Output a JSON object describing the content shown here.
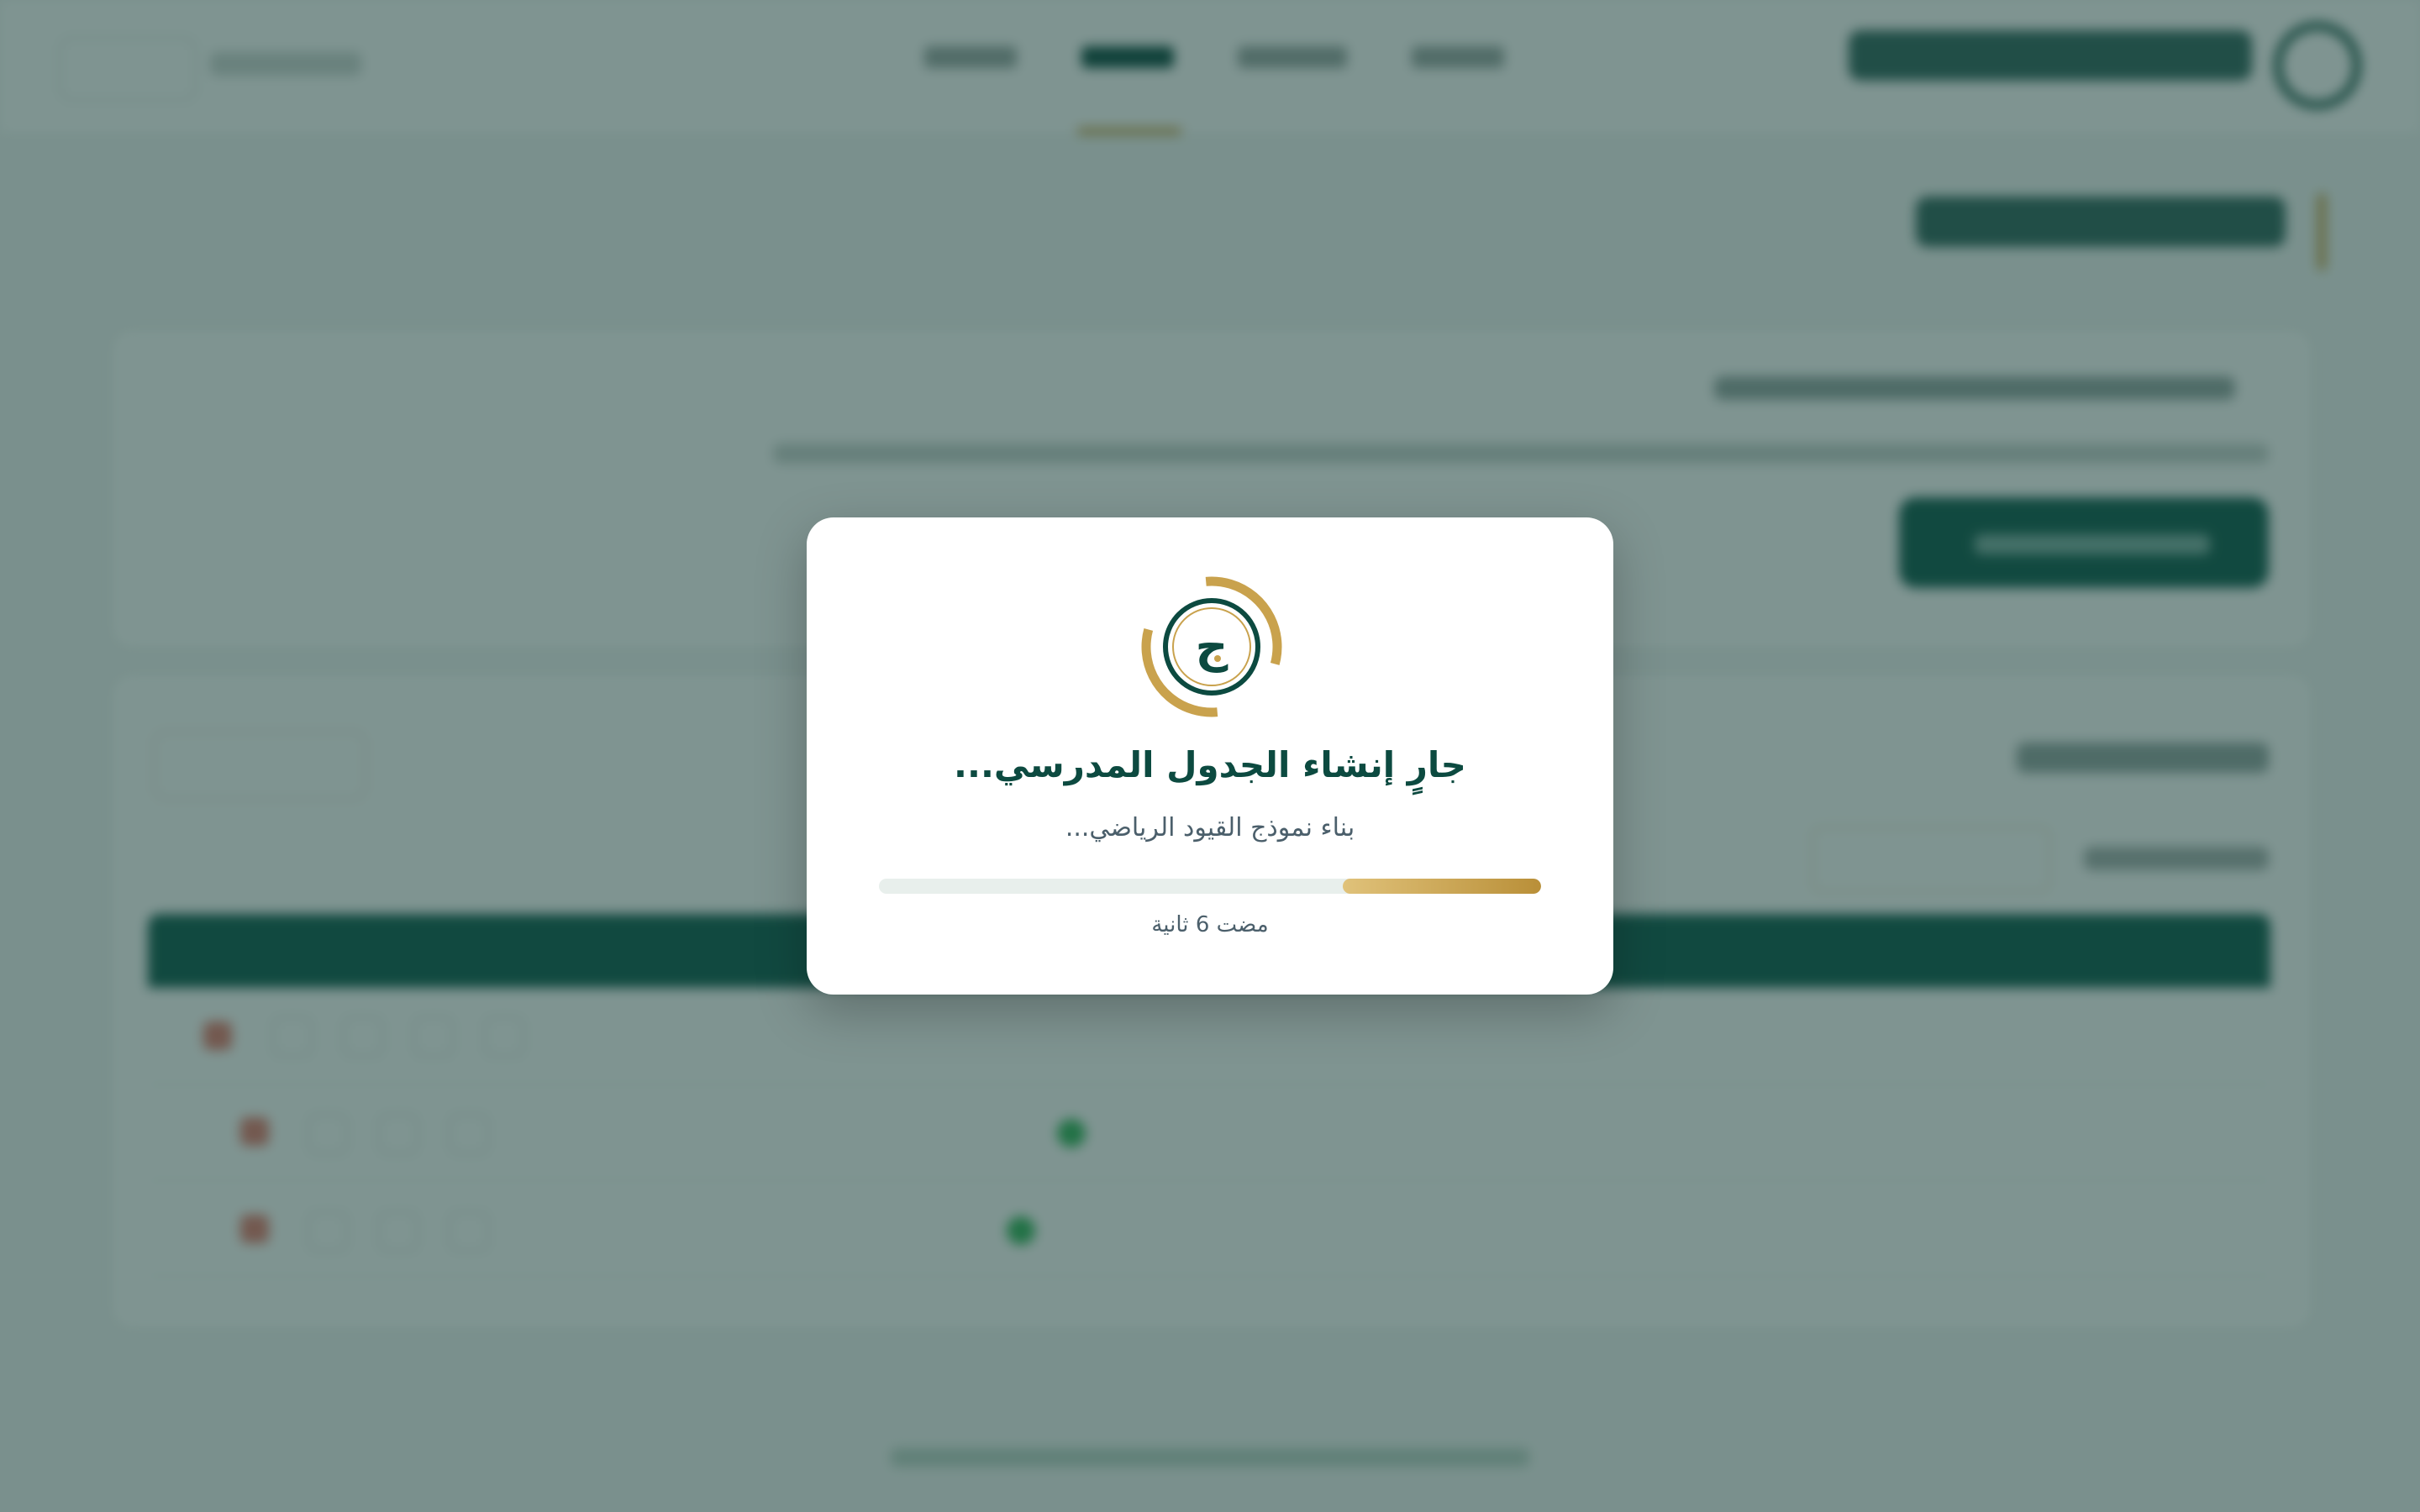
{
  "modal": {
    "logo_glyph": "ج",
    "title": "جارٍ إنشاء الجدول المدرسي...",
    "subtitle": "بناء نموذج القيود الرياضي...",
    "progress_fraction": 0.3,
    "elapsed": "مضت 6 ثانية"
  },
  "colors": {
    "primary": "#0d5a4c",
    "accent": "#c9a24d",
    "success": "#33b35a",
    "danger": "#e57c6e"
  },
  "icons": [
    "calendar-icon",
    "loading-spinner-icon",
    "delete-icon"
  ]
}
